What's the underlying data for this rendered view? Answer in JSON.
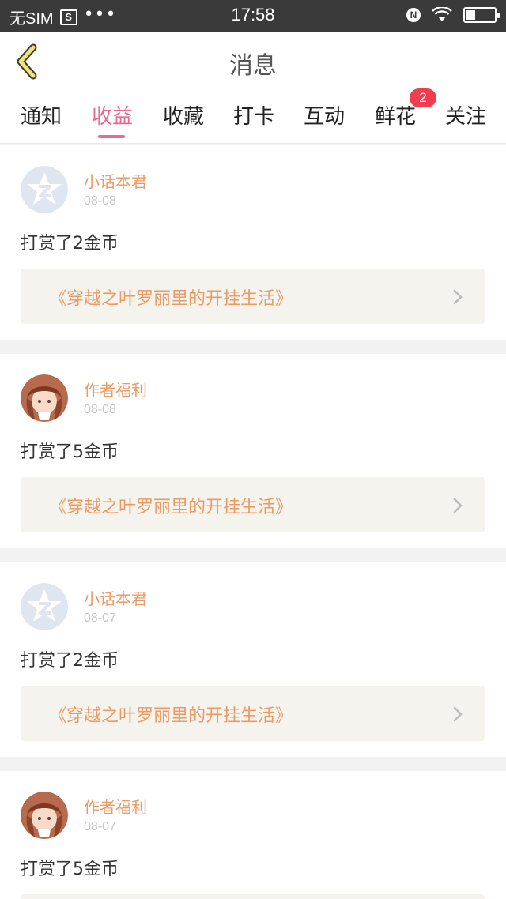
{
  "status_bar": {
    "carrier": "无SIM",
    "sim_icon_glyph": "S",
    "more": "•••",
    "time": "17:58",
    "nfc": "N"
  },
  "nav": {
    "title": "消息",
    "back_icon": "chevron-left-icon"
  },
  "tabs": [
    {
      "label": "通知"
    },
    {
      "label": "收益"
    },
    {
      "label": "收藏"
    },
    {
      "label": "打卡"
    },
    {
      "label": "互动"
    },
    {
      "label": "鲜花"
    },
    {
      "label": "关注"
    }
  ],
  "active_tab": "收益",
  "flower_badge": "2",
  "colors": {
    "accent": "#e56b93",
    "name": "#ec9a63",
    "badge": "#f23d4f",
    "book_bg": "#f4f3ee"
  },
  "feed": [
    {
      "name": "小话本君",
      "date": "08-08",
      "text": "打赏了2金币",
      "book": "《穿越之叶罗丽里的开挂生活》",
      "avatar": "qq-logo-avatar"
    },
    {
      "name": "作者福利",
      "date": "08-08",
      "text": "打赏了5金币",
      "book": "《穿越之叶罗丽里的开挂生活》",
      "avatar": "anime-girl-avatar"
    },
    {
      "name": "小话本君",
      "date": "08-07",
      "text": "打赏了2金币",
      "book": "《穿越之叶罗丽里的开挂生活》",
      "avatar": "qq-logo-avatar"
    },
    {
      "name": "作者福利",
      "date": "08-07",
      "text": "打赏了5金币",
      "avatar": "anime-girl-avatar"
    }
  ]
}
